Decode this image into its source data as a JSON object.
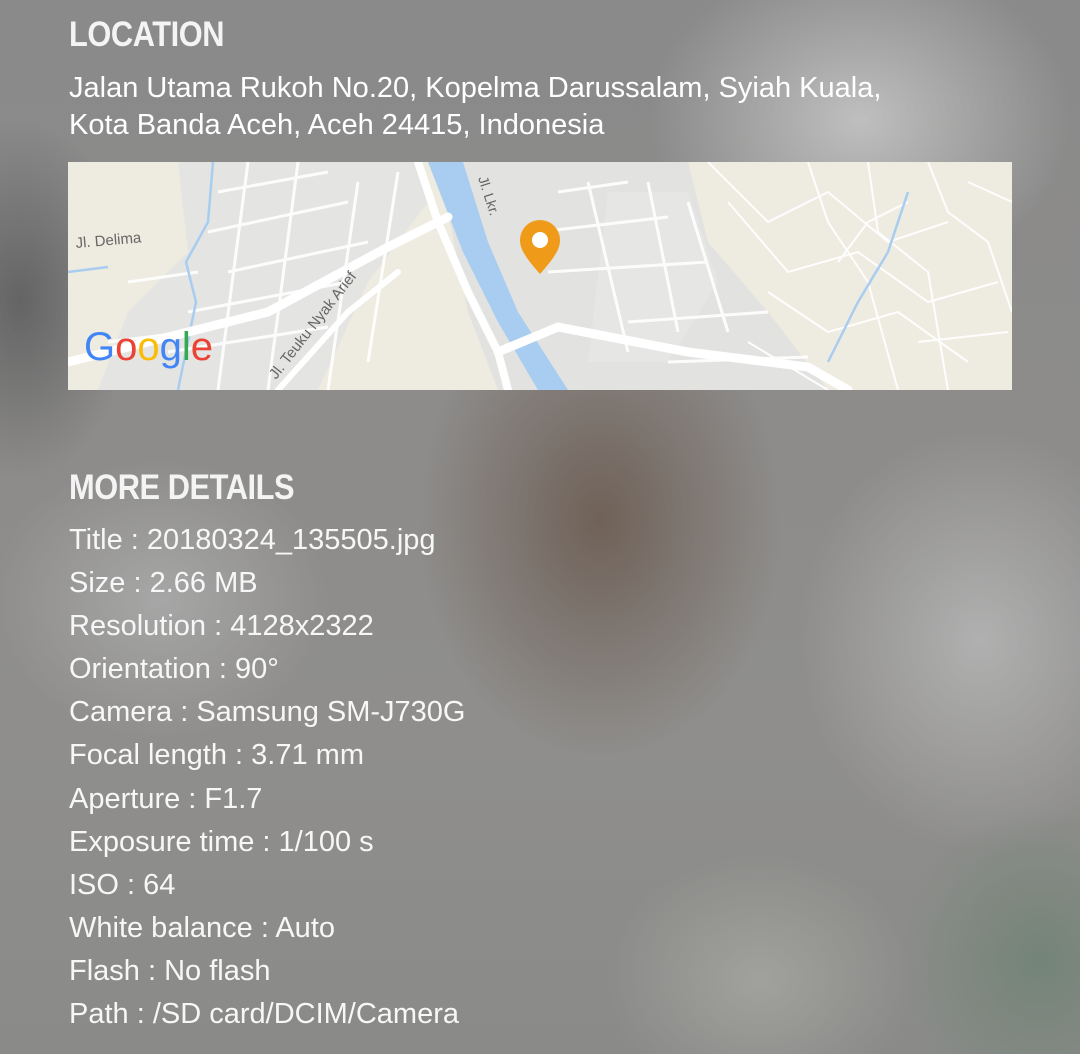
{
  "location": {
    "heading": "LOCATION",
    "address_line1": "Jalan Utama Rukoh No.20, Kopelma Darussalam, Syiah Kuala,",
    "address_line2": "Kota Banda Aceh, Aceh 24415, Indonesia",
    "map": {
      "labels": {
        "delima": "Jl. Delima",
        "teuku": "Jl. Teuku Nyak Arief",
        "lkr": "Jl. Lkr.",
        "google": "Google"
      },
      "pin_color": "#f09a1a",
      "river_color": "#a8cdf0"
    }
  },
  "details": {
    "heading": "MORE DETAILS",
    "title": "Title : 20180324_135505.jpg",
    "size": "Size : 2.66 MB",
    "resolution": "Resolution : 4128x2322",
    "orientation": "Orientation : 90°",
    "camera": "Camera : Samsung SM-J730G",
    "focal_length": "Focal length : 3.71 mm",
    "aperture": "Aperture : F1.7",
    "exposure": "Exposure time : 1/100 s",
    "iso": "ISO : 64",
    "white_balance": "White balance : Auto",
    "flash": "Flash : No flash",
    "path": "Path : /SD card/DCIM/Camera"
  }
}
